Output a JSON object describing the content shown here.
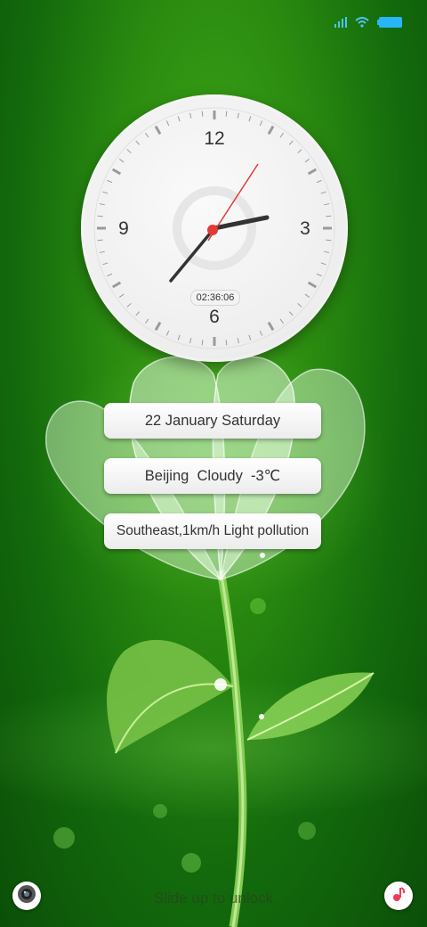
{
  "status_bar": {
    "icons": [
      "signal-icon",
      "wifi-icon",
      "battery-icon"
    ],
    "accent_color": "#29b6f6"
  },
  "clock": {
    "numerals": {
      "twelve": "12",
      "three": "3",
      "six": "6",
      "nine": "9"
    },
    "digital_time": "02:36:06",
    "second_hand_color": "#e53935"
  },
  "info": {
    "date": "22 January Saturday",
    "weather": "Beijing  Cloudy  -3℃",
    "wind_air": "Southeast,1km/h Light pollution"
  },
  "lock": {
    "hint": "Slide up to unlock",
    "left_shortcut_icon": "camera-icon",
    "right_shortcut_icon": "music-icon"
  }
}
